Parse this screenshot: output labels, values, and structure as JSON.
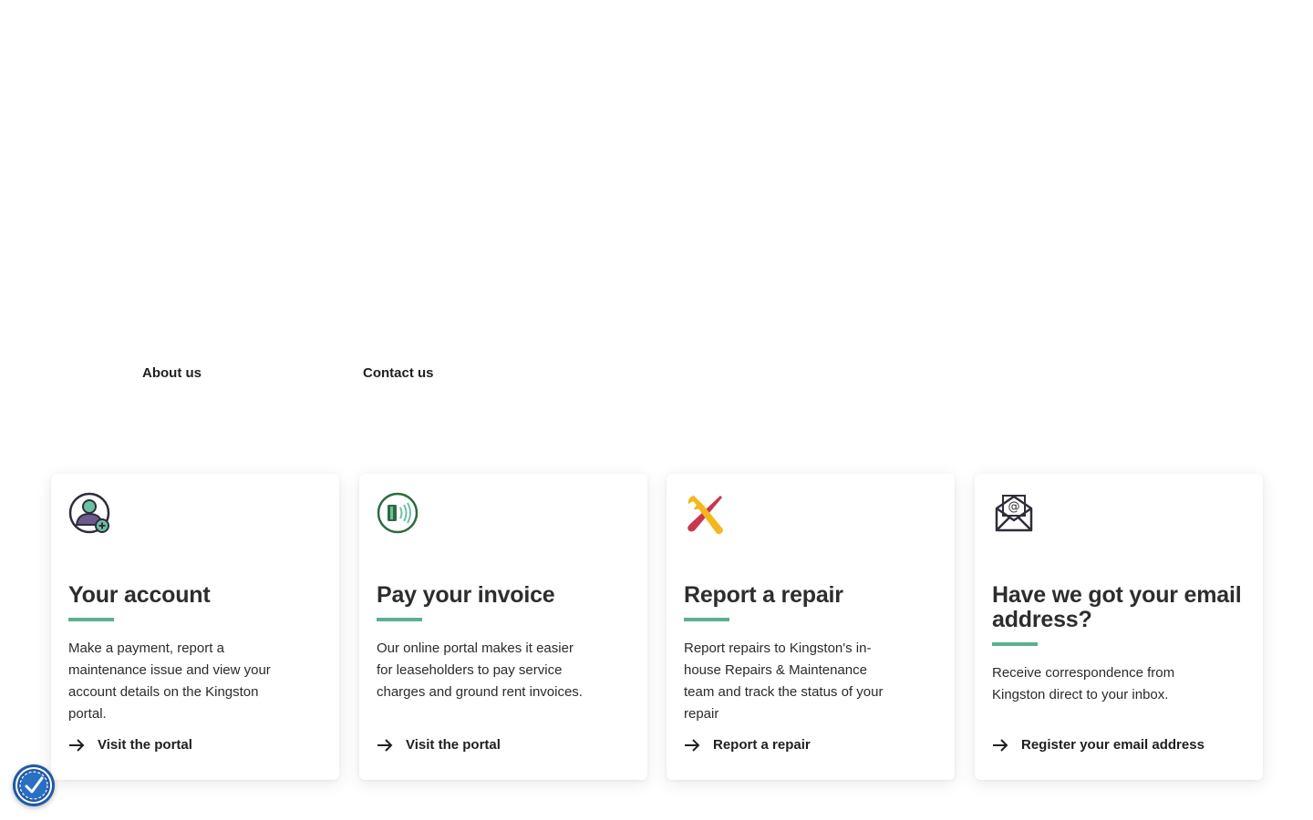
{
  "nav": {
    "about_label": "About us",
    "contact_label": "Contact us"
  },
  "cards": [
    {
      "icon": "user-account-icon",
      "title": "Your account",
      "body": "Make a payment, report a maintenance issue and view your account details on the Kingston portal.",
      "link_label": "Visit the portal"
    },
    {
      "icon": "contactless-card-icon",
      "title": "Pay your invoice",
      "body": "Our online portal makes it easier for leaseholders to pay service charges and ground rent invoices.",
      "link_label": "Visit the portal"
    },
    {
      "icon": "repair-tools-icon",
      "title": "Report a repair",
      "body": "Report repairs to Kingston's in-house Repairs & Maintenance team and track the status of your repair",
      "link_label": "Report a repair"
    },
    {
      "icon": "email-envelope-icon",
      "title": "Have we got your email address?",
      "body": "Receive correspondence from Kingston direct to your inbox.",
      "link_label": "Register your email address"
    }
  ],
  "colors": {
    "accent": "#5db08c",
    "text": "#2b2b2b",
    "badge": "#1f5aa6"
  },
  "accessibility": {
    "icon": "accessibility-icon"
  }
}
